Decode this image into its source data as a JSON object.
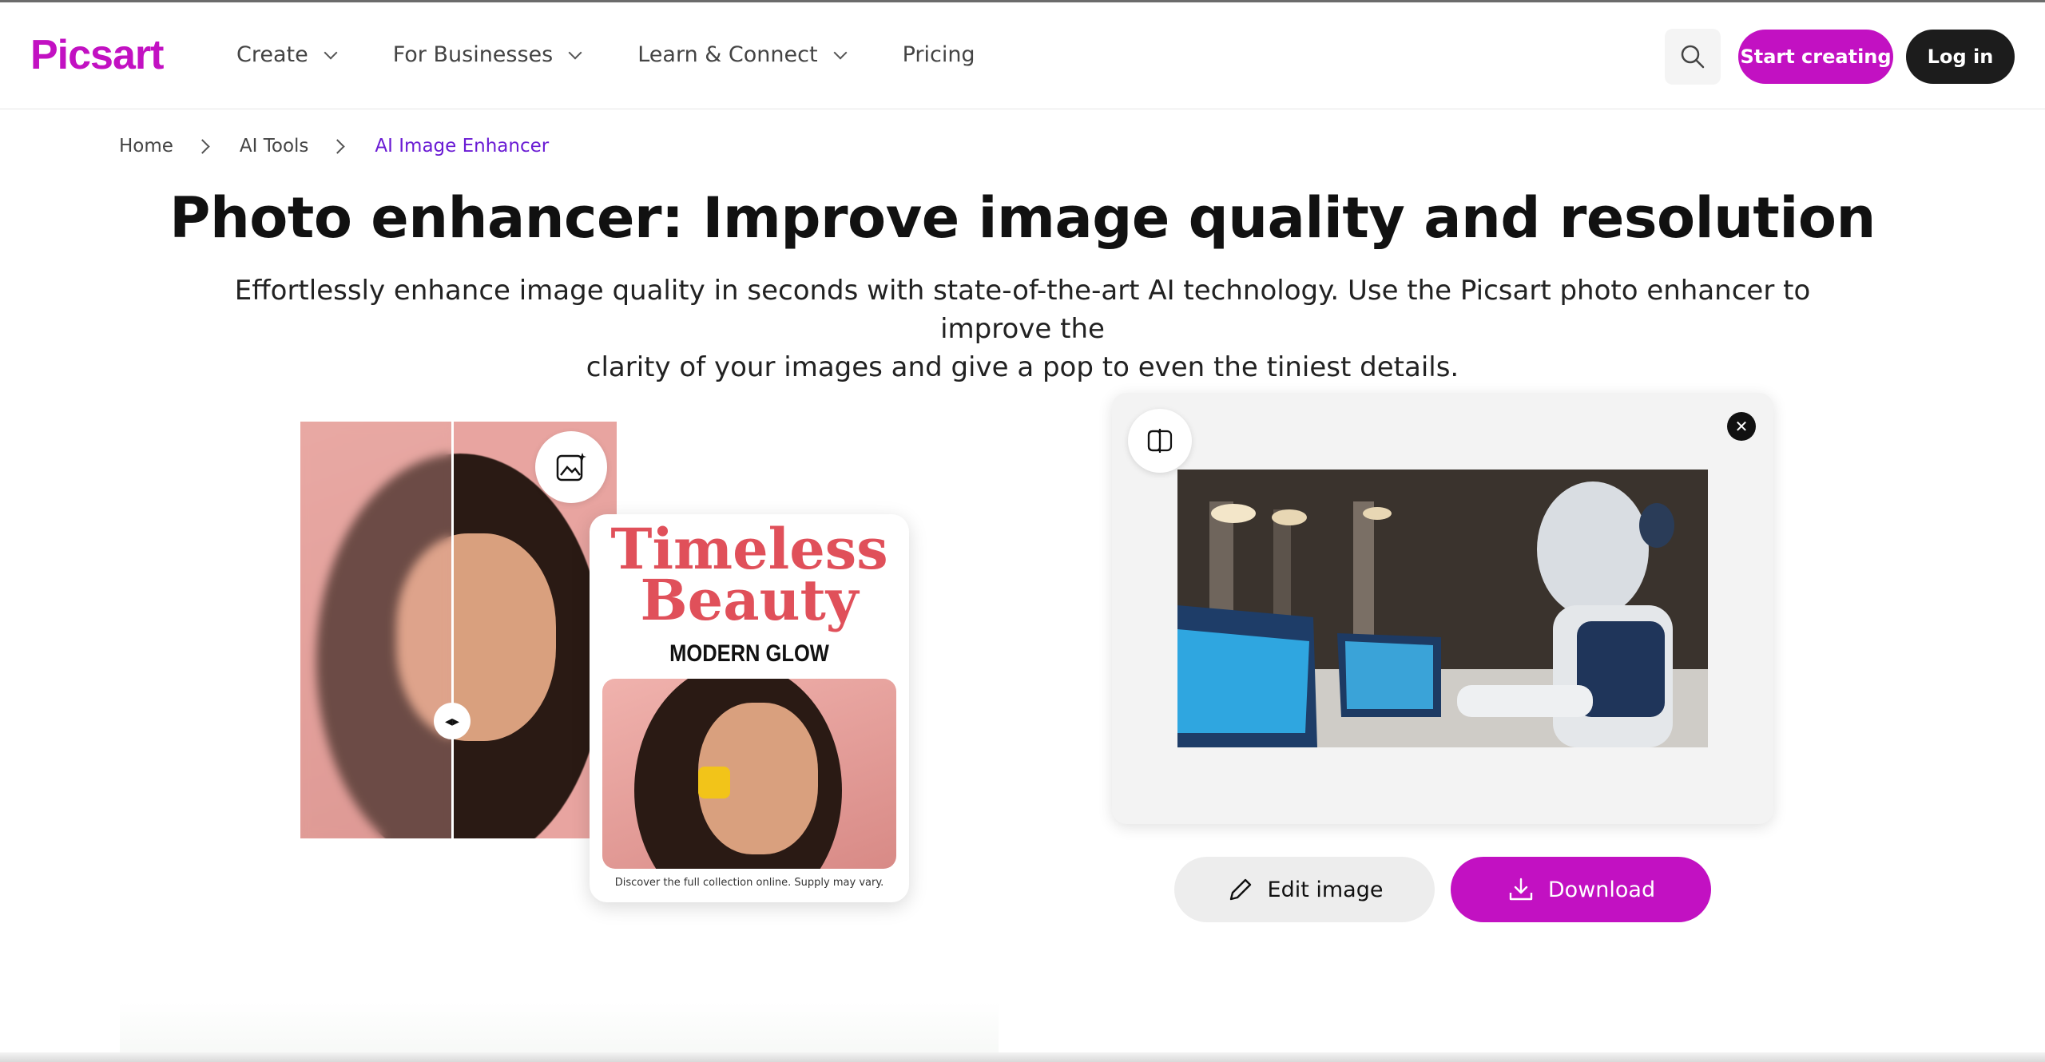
{
  "header": {
    "logo": "Picsart",
    "nav": [
      {
        "label": "Create",
        "has_dropdown": true
      },
      {
        "label": "For Businesses",
        "has_dropdown": true
      },
      {
        "label": "Learn & Connect",
        "has_dropdown": true
      },
      {
        "label": "Pricing",
        "has_dropdown": false
      }
    ],
    "start_label": "Start creating",
    "login_label": "Log in"
  },
  "breadcrumb": [
    "Home",
    "AI Tools",
    "AI Image Enhancer"
  ],
  "hero": {
    "title": "Photo enhancer: Improve image quality and resolution",
    "subtitle_line1": "Effortlessly enhance image quality in seconds with state-of-the-art AI technology. Use the Picsart photo enhancer to improve the",
    "subtitle_line2": "clarity of your images and give a pop to even the tiniest details."
  },
  "poster": {
    "title_line1": "Timeless",
    "title_line2": "Beauty",
    "subtitle": "MODERN GLOW",
    "footer": "Discover the full collection online. Supply may vary."
  },
  "preview_panel": {
    "edit_label": "Edit image",
    "download_label": "Download"
  },
  "colors": {
    "brand": "#c211c2",
    "dark": "#1c1c1c",
    "breadcrumb_active": "#6a1bd4",
    "poster_title": "#e0505a"
  }
}
